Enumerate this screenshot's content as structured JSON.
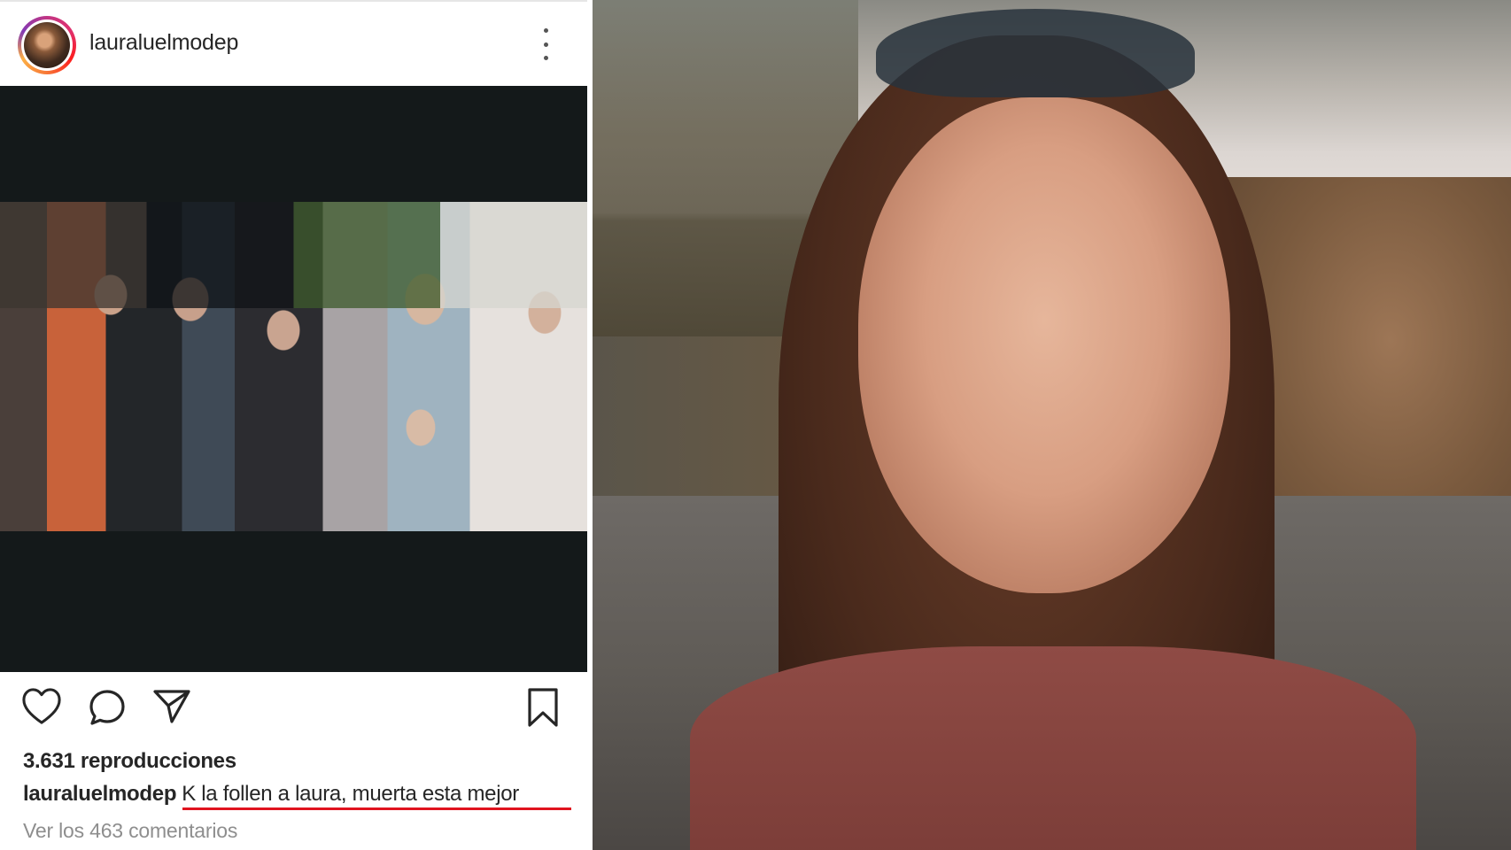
{
  "post": {
    "username": "lauraluelmodep",
    "views": "3.631 reproducciones",
    "caption": {
      "user": "lauraluelmodep",
      "text": "K la follen a laura, muerta esta mejor"
    },
    "comments_link": "Ver los 463 comentarios"
  },
  "icons": {
    "like": "heart-icon",
    "comment": "comment-icon",
    "share": "paper-plane-icon",
    "save": "bookmark-icon",
    "more": "more-vertical-icon"
  },
  "colors": {
    "text": "#262626",
    "muted": "#8e8e8e",
    "underline": "#e0131f",
    "media_background": "#14191a"
  }
}
